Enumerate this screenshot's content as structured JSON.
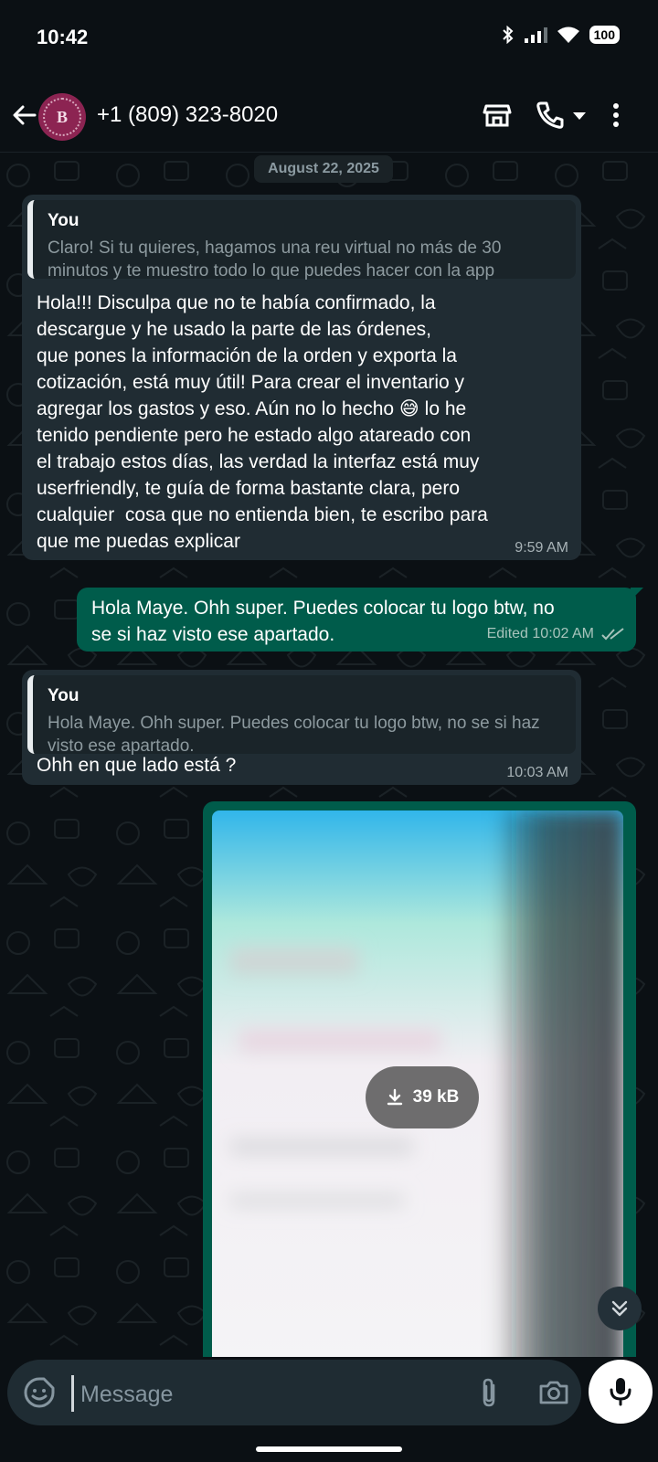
{
  "status_bar": {
    "time": "10:42",
    "battery": "100"
  },
  "header": {
    "contact_name": "+1 (809) 323-8020",
    "avatar_letter": "B"
  },
  "chat": {
    "date_chip": "August 22, 2025",
    "messages": [
      {
        "quote_author": "You",
        "quote_text": "Claro! Si tu quieres, hagamos una reu virtual no más de 30 minutos y te muestro todo lo que puedes hacer con la app",
        "text": "Hola!!! Disculpa que no te había confirmado, la\ndescargue y he usado la parte de las órdenes,\nque pones la información de la orden y exporta la\ncotización, está muy útil! Para crear el inventario y\nagregar los gastos y eso. Aún no lo hecho 😅 lo he\ntenido pendiente pero he estado algo atareado con\nel trabajo estos días, las verdad la interfaz está muy\nuserfriendly, te guía de forma bastante clara, pero\ncualquier  cosa que no entienda bien, te escribo para\nque me puedas explicar",
        "time": "9:59 AM"
      },
      {
        "text": "Hola Maye. Ohh super. Puedes colocar tu logo btw, no\nse si haz visto ese apartado.",
        "time": "Edited 10:02 AM"
      },
      {
        "quote_author": "You",
        "quote_text": "Hola Maye. Ohh super. Puedes colocar tu logo btw, no se si haz visto ese apartado.",
        "text": "Ohh en que lado está ?",
        "time": "10:03 AM"
      }
    ],
    "image_download_size": "39 kB"
  },
  "composer": {
    "placeholder": "Message"
  },
  "icons": {
    "back": "arrow-left-icon",
    "store": "store-icon",
    "call": "phone-icon",
    "call_menu": "dropdown-caret-icon",
    "more": "more-vert-icon",
    "emoji": "sticker-smile-icon",
    "attach": "paperclip-icon",
    "camera": "camera-icon",
    "mic": "mic-icon",
    "scroll": "double-chevron-down-icon",
    "download": "download-icon"
  },
  "colors": {
    "background": "#0b1014",
    "incoming_bubble": "#202c33",
    "outgoing_bubble": "#005c4b",
    "read_ticks": "#a8c4bc"
  }
}
